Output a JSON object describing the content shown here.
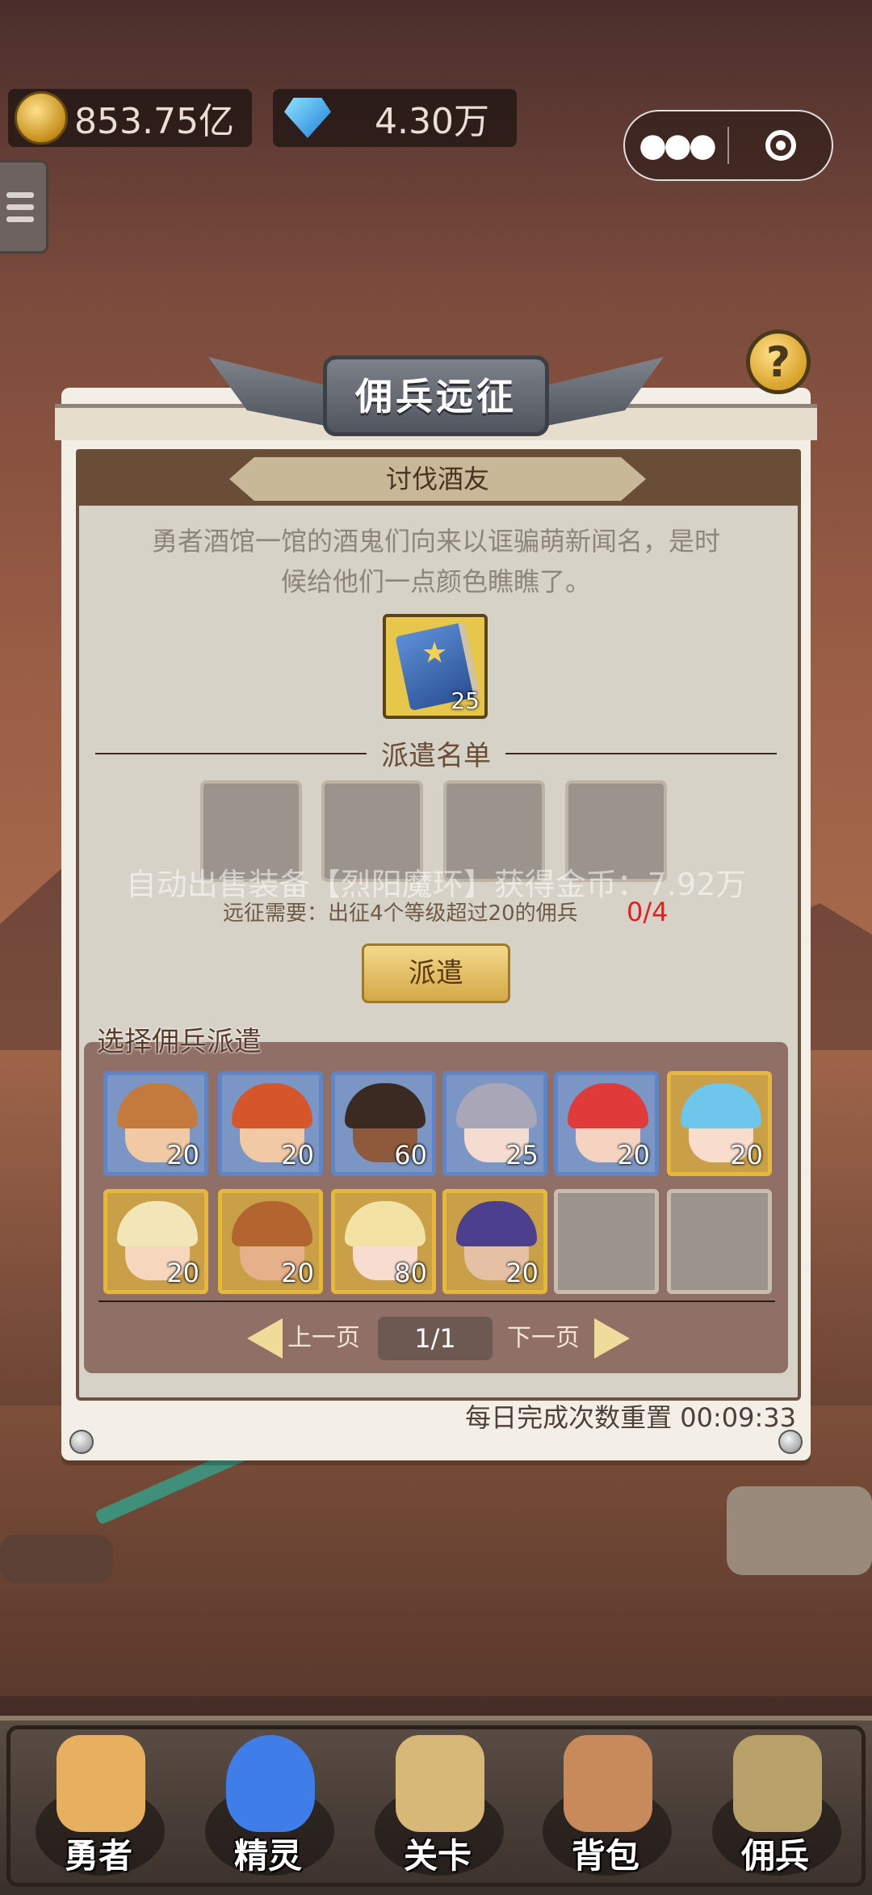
{
  "currency": {
    "gold": "853.75亿",
    "gems": "4.30万"
  },
  "panel": {
    "title": "佣兵远征",
    "mission_title": "讨伐酒友",
    "description_line1": "勇者酒馆一馆的酒鬼们向来以诓骗萌新闻名，是时",
    "description_line2": "候给他们一点颜色瞧瞧了。",
    "reward": {
      "icon": "blue-book-icon",
      "count": "25"
    },
    "dispatch_list_label": "派遣名单",
    "slots": 4,
    "toast": "自动出售装备【烈阳魔环】获得金币：7.92万",
    "requirement": "远征需要：出征4个等级超过20的佣兵",
    "requirement_progress": "0/4",
    "dispatch_button": "派遣",
    "select_label": "选择佣兵派遣",
    "heroes": [
      {
        "level": "20",
        "frame": "blue",
        "hair": "#c47a3c",
        "skin": "#f2c9a5"
      },
      {
        "level": "20",
        "frame": "blue",
        "hair": "#d4562a",
        "skin": "#f2c9a5"
      },
      {
        "level": "60",
        "frame": "blue",
        "hair": "#3a2a22",
        "skin": "#8f5a3c"
      },
      {
        "level": "25",
        "frame": "blue",
        "hair": "#a9a6b8",
        "skin": "#f4dcd0"
      },
      {
        "level": "20",
        "frame": "blue",
        "hair": "#e03a3a",
        "skin": "#f6d2c0"
      },
      {
        "level": "20",
        "frame": "gold",
        "hair": "#6ec6ec",
        "skin": "#f8dccc"
      },
      {
        "level": "20",
        "frame": "gold",
        "hair": "#f2e6b8",
        "skin": "#f6d6bc"
      },
      {
        "level": "20",
        "frame": "gold",
        "hair": "#b2652e",
        "skin": "#e6b08a"
      },
      {
        "level": "80",
        "frame": "gold",
        "hair": "#f2e3a4",
        "skin": "#f8dcd0"
      },
      {
        "level": "20",
        "frame": "gold",
        "hair": "#4c3f8e",
        "skin": "#e6c0a4"
      },
      {
        "level": "",
        "frame": "empty"
      },
      {
        "level": "",
        "frame": "empty"
      }
    ],
    "prev_page": "上一页",
    "page_indicator": "1/1",
    "next_page": "下一页",
    "reset_text": "每日完成次数重置 00:09:33"
  },
  "nav": {
    "items": [
      {
        "label": "勇者",
        "icon": "hero-icon"
      },
      {
        "label": "精灵",
        "icon": "spirit-icon"
      },
      {
        "label": "关卡",
        "icon": "map-scroll-icon"
      },
      {
        "label": "背包",
        "icon": "backpack-icon"
      },
      {
        "label": "佣兵",
        "icon": "mercenary-helmet-icon"
      }
    ]
  }
}
